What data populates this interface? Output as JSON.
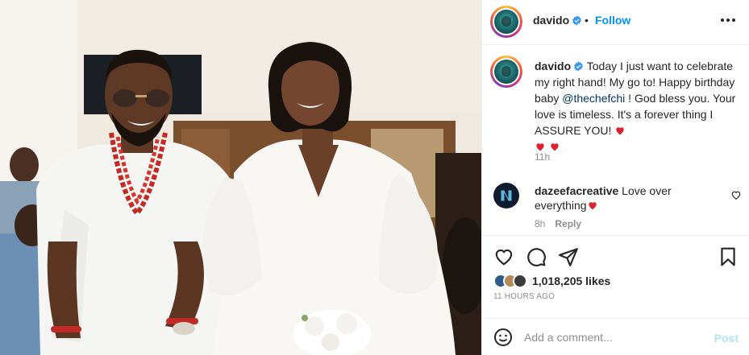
{
  "post": {
    "image_alt": "Man in white agbada with coral beads and woman in white dress smiling",
    "author": {
      "username": "davido",
      "verified": true,
      "verified_icon": "verified-badge-icon",
      "follow_label": "Follow",
      "separator": "•",
      "more_icon": "more-options-icon"
    },
    "caption": {
      "username": "davido",
      "text_before_mention": " Today I just want to celebrate my right hand! My go to! Happy birthday baby ",
      "mention": "@thechefchi",
      "text_after_mention": " ! God bless you. Your love is timeless. It's a forever thing I ASSURE YOU! ",
      "emojis": [
        "heart-emoji",
        "heart-emoji",
        "heart-emoji"
      ],
      "time": "11h"
    },
    "comments": [
      {
        "username": "dazeefacreative",
        "text": " Love over everything",
        "emoji": "heart-emoji",
        "time": "8h",
        "reply_label": "Reply",
        "like_icon": "heart-outline-icon"
      }
    ],
    "actions": {
      "like_icon": "heart-outline-icon",
      "comment_icon": "comment-bubble-icon",
      "share_icon": "paper-plane-icon",
      "save_icon": "bookmark-icon"
    },
    "likes": {
      "count_label": "1,018,205 likes"
    },
    "timestamp": "11 HOURS AGO",
    "add_comment": {
      "placeholder": "Add a comment...",
      "post_label": "Post",
      "emoji_icon": "smiley-face-icon"
    }
  },
  "colors": {
    "accent": "#0095f6",
    "text": "#262626",
    "muted": "#8e8e8e",
    "heart": "#ed4956",
    "post_disabled": "#b2dffc",
    "mention": "#00376b"
  }
}
